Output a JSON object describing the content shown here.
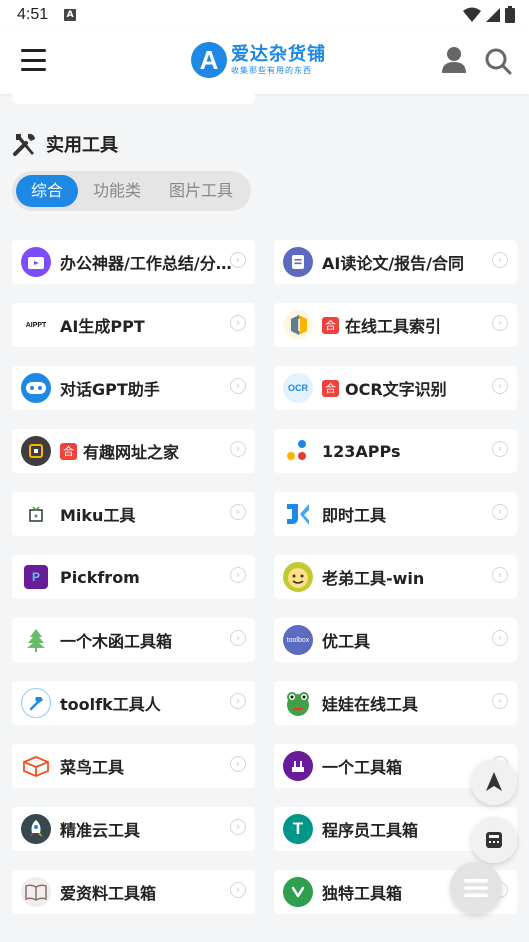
{
  "status": {
    "time": "4:51",
    "notif_icon": "A"
  },
  "header": {
    "logo_letter": "A",
    "title": "爱达杂货铺",
    "subtitle": "收集那些有用的东西"
  },
  "section": {
    "title": "实用工具"
  },
  "tabs": [
    {
      "label": "综合",
      "active": true
    },
    {
      "label": "功能类",
      "active": false
    },
    {
      "label": "图片工具",
      "active": false
    }
  ],
  "tools": [
    {
      "name": "办公神器/工作总结/分...",
      "icon": "bilibili-tv-icon",
      "icon_text": "",
      "color": "#7c4dff"
    },
    {
      "name": "AI读论文/报告/合同",
      "icon": "document-icon",
      "icon_text": "",
      "color": "#5c6bc0"
    },
    {
      "name": "AI生成PPT",
      "icon": "aippt-logo-icon",
      "icon_text": "AIPPT",
      "color": "#ffffff"
    },
    {
      "name": "在线工具索引",
      "icon": "layers-icon",
      "icon_text": "",
      "color": "#fff8e1",
      "tag": "合"
    },
    {
      "name": "对话GPT助手",
      "icon": "gpt-bot-icon",
      "icon_text": "",
      "color": "#1e88e5"
    },
    {
      "name": "OCR文字识别",
      "icon": "ocr-icon",
      "icon_text": "OCR",
      "color": "#e3f2fd",
      "tag": "合"
    },
    {
      "name": "有趣网址之家",
      "icon": "site-home-icon",
      "icon_text": "",
      "color": "#3e3e3e",
      "tag": "合"
    },
    {
      "name": "123APPs",
      "icon": "dots-icon",
      "icon_text": "",
      "color": "#ffffff"
    },
    {
      "name": "Miku工具",
      "icon": "miku-box-icon",
      "icon_text": "",
      "color": "#ffffff"
    },
    {
      "name": "即时工具",
      "icon": "js-logo-icon",
      "icon_text": "",
      "color": "#ffffff"
    },
    {
      "name": "Pickfrom",
      "icon": "pickfrom-icon",
      "icon_text": "P",
      "color": "#6a1b9a"
    },
    {
      "name": "老弟工具-win",
      "icon": "smile-face-icon",
      "icon_text": "",
      "color": "#c0ca33"
    },
    {
      "name": "一个木函工具箱",
      "icon": "tree-icon",
      "icon_text": "",
      "color": "#ffffff"
    },
    {
      "name": "优工具",
      "icon": "toolbox-logo-icon",
      "icon_text": "toolbox",
      "color": "#5c6bc0"
    },
    {
      "name": "toolfk工具人",
      "icon": "hammer-icon",
      "icon_text": "",
      "color": "#e3f2fd"
    },
    {
      "name": "娃娃在线工具",
      "icon": "frog-icon",
      "icon_text": "",
      "color": "#43a047"
    },
    {
      "name": "菜鸟工具",
      "icon": "box-outline-icon",
      "icon_text": "",
      "color": "#ffffff"
    },
    {
      "name": "一个工具箱",
      "icon": "toolkit-icon",
      "icon_text": "",
      "color": "#6a1b9a"
    },
    {
      "name": "精准云工具",
      "icon": "rocket-icon",
      "icon_text": "",
      "color": "#37474f"
    },
    {
      "name": "程序员工具箱",
      "icon": "t-logo-icon",
      "icon_text": "T",
      "color": "#009688"
    },
    {
      "name": "爱资料工具箱",
      "icon": "book-icon",
      "icon_text": "",
      "color": "#eeeeee"
    },
    {
      "name": "独特工具箱",
      "icon": "slash-logo-icon",
      "icon_text": "",
      "color": "#2e9e4f"
    }
  ]
}
